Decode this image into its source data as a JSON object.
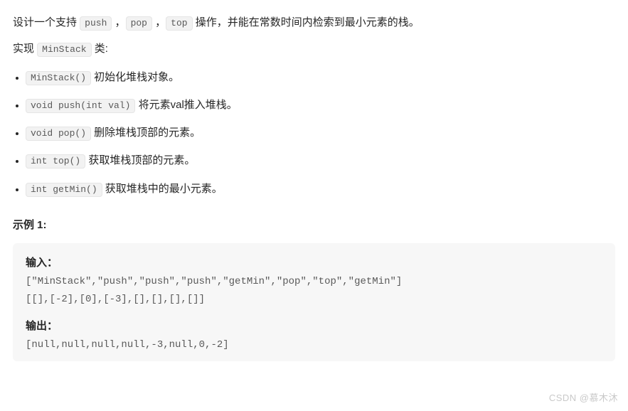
{
  "intro": {
    "prefix": "设计一个支持 ",
    "op1": "push",
    "sep1": " ，",
    "op2": "pop",
    "sep2": " ，",
    "op3": "top",
    "suffix": " 操作，并能在常数时间内检索到最小元素的栈。"
  },
  "implement": {
    "prefix": "实现 ",
    "class_name": "MinStack",
    "suffix": " 类:"
  },
  "methods": [
    {
      "sig": "MinStack()",
      "desc": " 初始化堆栈对象。"
    },
    {
      "sig": "void push(int val)",
      "desc": " 将元素val推入堆栈。"
    },
    {
      "sig": "void pop()",
      "desc": " 删除堆栈顶部的元素。"
    },
    {
      "sig": "int top()",
      "desc": " 获取堆栈顶部的元素。"
    },
    {
      "sig": "int getMin()",
      "desc": " 获取堆栈中的最小元素。"
    }
  ],
  "example": {
    "heading": "示例 1:",
    "input_label": "输入：",
    "input_line1": "[\"MinStack\",\"push\",\"push\",\"push\",\"getMin\",\"pop\",\"top\",\"getMin\"]",
    "input_line2": "[[],[-2],[0],[-3],[],[],[],[]]",
    "output_label": "输出：",
    "output_line": "[null,null,null,null,-3,null,0,-2]"
  },
  "watermark": "CSDN @慕木沐"
}
